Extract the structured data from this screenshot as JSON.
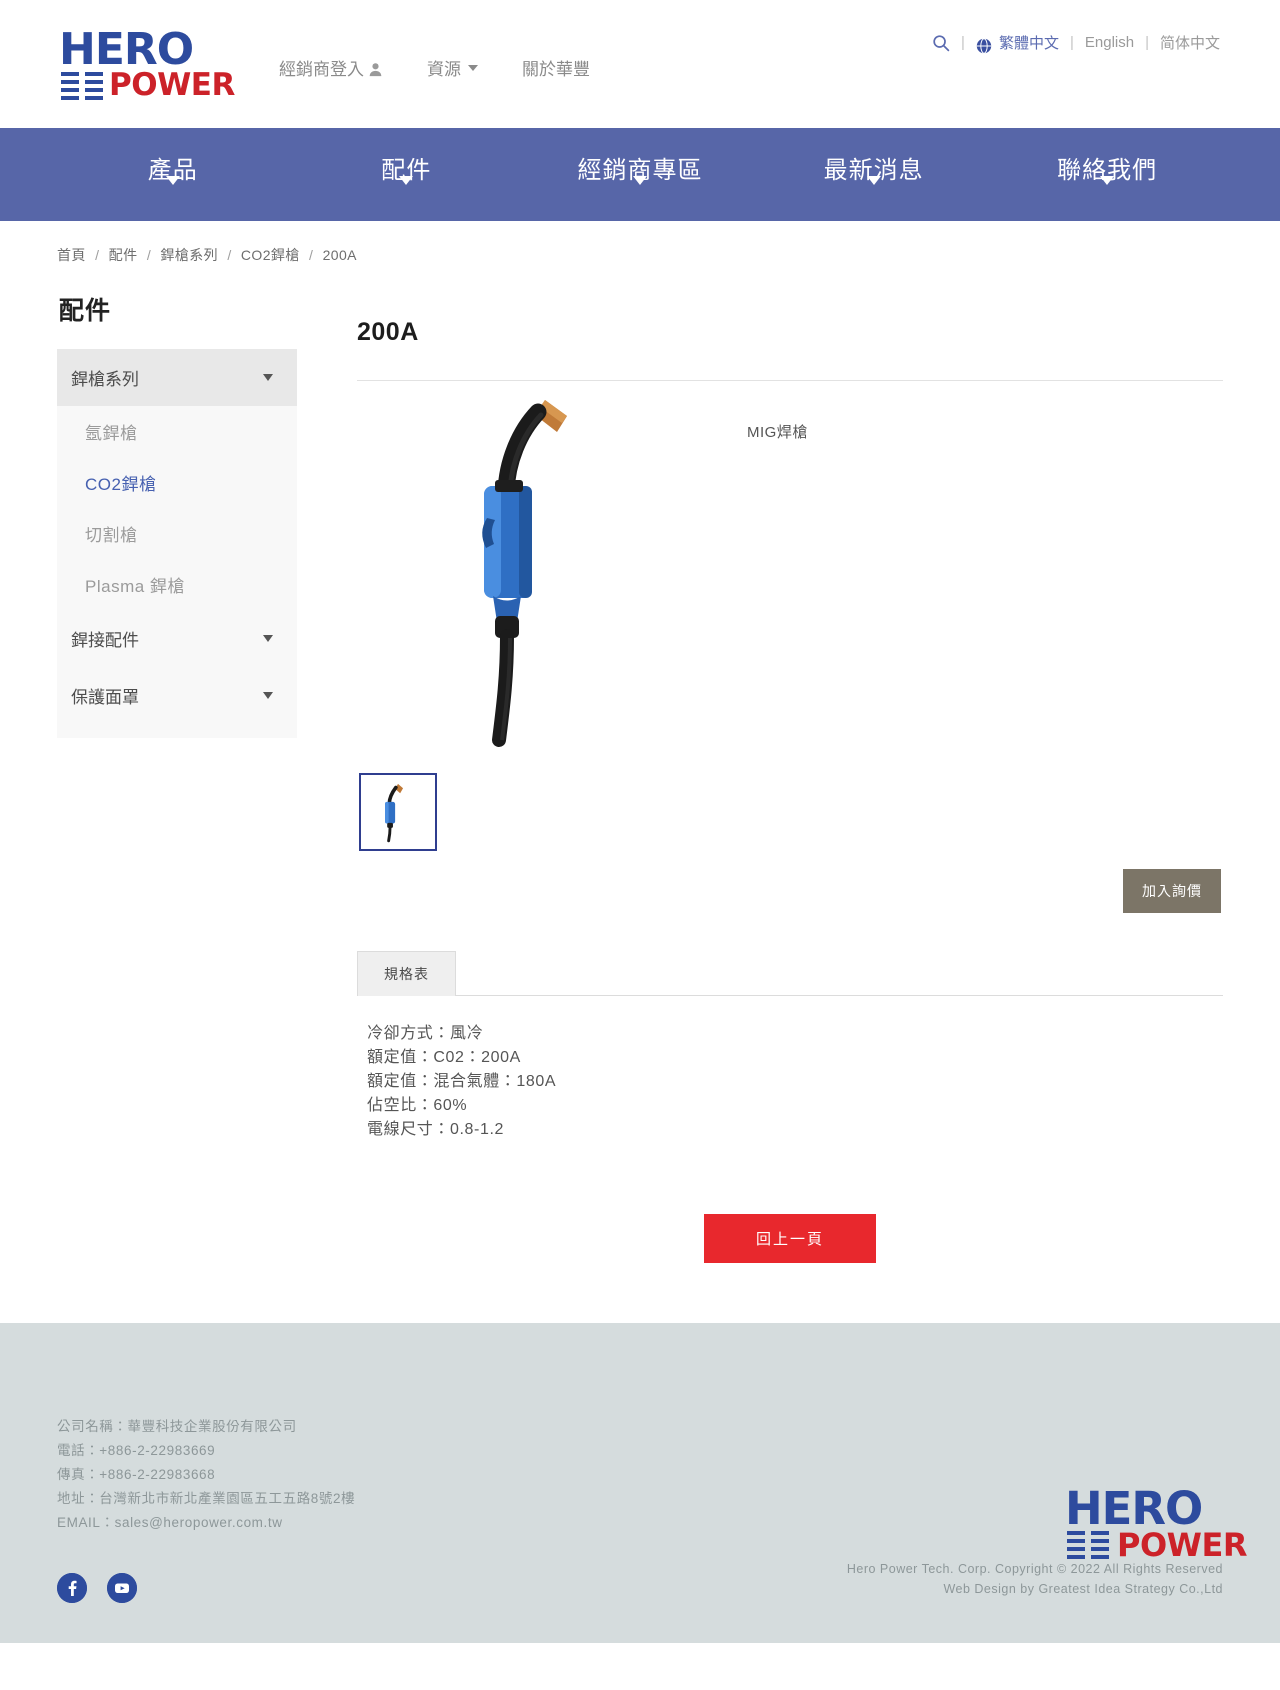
{
  "brand": {
    "logo_top": "HERO",
    "logo_bottom": "POWER",
    "color_blue": "#2d4b9e",
    "color_red": "#cc2229"
  },
  "topbar": {
    "nav": [
      {
        "label": "經銷商登入",
        "icon": "person-icon",
        "caret": false
      },
      {
        "label": "資源",
        "icon": "",
        "caret": true
      },
      {
        "label": "關於華豐",
        "icon": "",
        "caret": false
      }
    ],
    "search_icon": "search-icon",
    "globe_icon": "globe-icon",
    "languages": [
      {
        "label": "繁體中文",
        "active": true
      },
      {
        "label": "English",
        "active": false
      },
      {
        "label": "简体中文",
        "active": false
      }
    ],
    "separator": "|"
  },
  "mainnav": {
    "bg_color": "#5766a8",
    "items": [
      {
        "label": "產品"
      },
      {
        "label": "配件"
      },
      {
        "label": "經銷商專區"
      },
      {
        "label": "最新消息"
      },
      {
        "label": "聯絡我們"
      }
    ]
  },
  "breadcrumb": {
    "separator": "/",
    "items": [
      "首頁",
      "配件",
      "銲槍系列",
      "CO2銲槍",
      "200A"
    ]
  },
  "sidebar": {
    "title": "配件",
    "groups": [
      {
        "label": "銲槍系列",
        "open": true,
        "children": [
          {
            "label": "氬銲槍",
            "active": false
          },
          {
            "label": "CO2銲槍",
            "active": true
          },
          {
            "label": "切割槍",
            "active": false
          },
          {
            "label": "Plasma 銲槍",
            "active": false
          }
        ]
      },
      {
        "label": "銲接配件",
        "open": false,
        "children": []
      },
      {
        "label": "保護面罩",
        "open": false,
        "children": []
      }
    ]
  },
  "product": {
    "title": "200A",
    "image_caption": "MIG焊槍",
    "thumbnail_alt": "200A MIG 焊槍縮圖",
    "inquiry_button": "加入詢價",
    "tabs": [
      {
        "label": "規格表",
        "active": true
      }
    ],
    "spec_lines": [
      "冷卻方式：風冷",
      "額定值：C02：200A",
      "額定值：混合氣體：180A",
      "佔空比：60%",
      "電線尺寸：0.8-1.2"
    ],
    "back_button": "回上一頁"
  },
  "footer": {
    "bg_color": "#d5dcdd",
    "contact": [
      "公司名稱：華豐科技企業股份有限公司",
      "電話：+886-2-22983669",
      "傳真：+886-2-22983668",
      "地址：台灣新北市新北產業園區五工五路8號2樓",
      "EMAIL：sales@heropower.com.tw"
    ],
    "social": [
      {
        "name": "facebook-icon",
        "glyph": "f"
      },
      {
        "name": "youtube-icon",
        "glyph": "▶"
      }
    ],
    "copyright_line1": "Hero Power Tech. Corp. Copyright © 2022 All Rights Reserved",
    "copyright_line2": "Web Design by Greatest Idea Strategy Co.,Ltd"
  }
}
